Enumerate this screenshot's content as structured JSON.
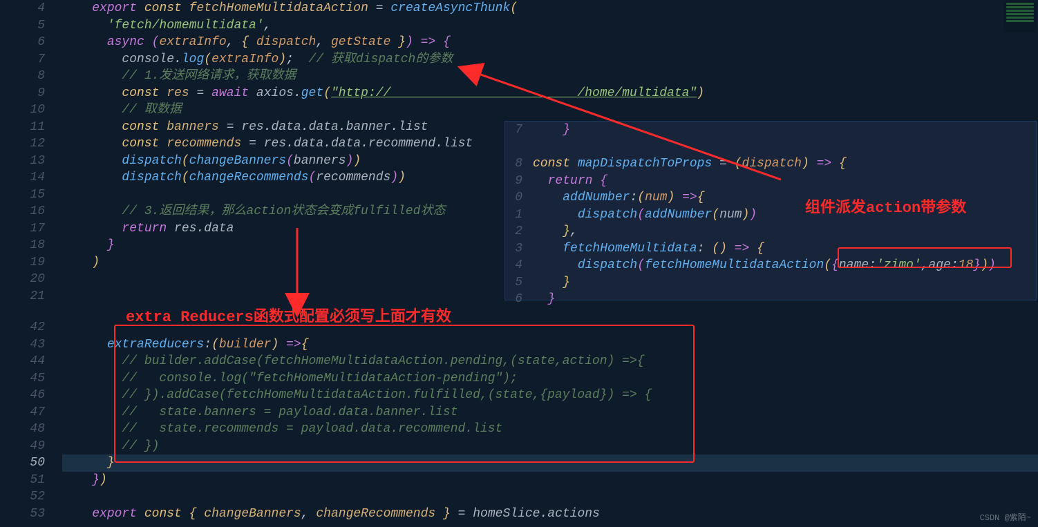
{
  "panel1": {
    "lines": [
      {
        "n": 4,
        "html": "<span class='k-export'>export</span> <span class='k-const'>const</span> <span class='varDef'>fetchHomeMultidataAction</span> <span class='punc'>=</span> <span class='fn'>createAsyncThunk</span><span class='yellow'>(</span>"
      },
      {
        "n": 5,
        "html": "  <span class='str'>'fetch/homemultidata'</span><span class='white'>,</span>"
      },
      {
        "n": 6,
        "html": "  <span class='k-async'>async</span> <span class='purple'>(</span><span class='orange'>extraInfo</span><span class='white'>,</span> <span class='yellow'>{</span> <span class='orange'>dispatch</span><span class='white'>,</span> <span class='orange'>getState</span> <span class='yellow'>}</span><span class='purple'>)</span> <span class='purple'>=&gt;</span> <span class='purple'>{</span>"
      },
      {
        "n": 7,
        "html": "    <span class='var'>console</span><span class='white'>.</span><span class='fn'>log</span><span class='yellow'>(</span><span class='orange'>extraInfo</span><span class='yellow'>)</span><span class='white'>;</span>  <span class='cmt'>// 获取dispatch的参数</span>"
      },
      {
        "n": 8,
        "html": "    <span class='cmt'>// 1.发送网络请求，获取数据</span>"
      },
      {
        "n": 9,
        "html": "    <span class='k-const'>const</span> <span class='varDef'>res</span> <span class='punc'>=</span> <span class='k-await'>await</span> <span class='var'>axios</span><span class='white'>.</span><span class='fn'>get</span><span class='yellow'>(</span><span class='strUrl'>\"http://                         /home/multidata\"</span><span class='yellow'>)</span>"
      },
      {
        "n": 10,
        "html": "    <span class='cmt'>// 取数据</span>"
      },
      {
        "n": 11,
        "html": "    <span class='k-const'>const</span> <span class='varDef'>banners</span> <span class='punc'>=</span> <span class='var'>res</span><span class='white'>.</span><span class='prop'>data</span><span class='white'>.</span><span class='prop'>data</span><span class='white'>.</span><span class='prop'>banner</span><span class='white'>.</span><span class='prop'>list</span>"
      },
      {
        "n": 12,
        "html": "    <span class='k-const'>const</span> <span class='varDef'>recommends</span> <span class='punc'>=</span> <span class='var'>res</span><span class='white'>.</span><span class='prop'>data</span><span class='white'>.</span><span class='prop'>data</span><span class='white'>.</span><span class='prop'>recommend</span><span class='white'>.</span><span class='prop'>list</span>"
      },
      {
        "n": 13,
        "html": "    <span class='fn'>dispatch</span><span class='yellow'>(</span><span class='fn'>changeBanners</span><span class='purple'>(</span><span class='var'>banners</span><span class='purple'>)</span><span class='yellow'>)</span>"
      },
      {
        "n": 14,
        "html": "    <span class='fn'>dispatch</span><span class='yellow'>(</span><span class='fn'>changeRecommends</span><span class='purple'>(</span><span class='var'>recommends</span><span class='purple'>)</span><span class='yellow'>)</span>"
      },
      {
        "n": 15,
        "html": ""
      },
      {
        "n": 16,
        "html": "    <span class='cmt'>// 3.返回结果，那么action状态会变成fulfilled状态</span>"
      },
      {
        "n": 17,
        "html": "    <span class='k-return'>return</span> <span class='var'>res</span><span class='white'>.</span><span class='prop'>data</span>"
      },
      {
        "n": 18,
        "html": "  <span class='purple'>}</span>"
      },
      {
        "n": 19,
        "html": "<span class='yellow'>)</span>"
      },
      {
        "n": 20,
        "html": ""
      },
      {
        "n": 21,
        "html": ""
      }
    ]
  },
  "panel3": {
    "lines": [
      {
        "n": 42,
        "html": ""
      },
      {
        "n": 43,
        "html": "  <span class='fn'>extraReducers</span><span class='white'>:</span><span class='yellow'>(</span><span class='orange'>builder</span><span class='yellow'>)</span> <span class='purple'>=&gt;</span><span class='yellow'>{</span>"
      },
      {
        "n": 44,
        "html": "    <span class='cmt'>// builder.addCase(fetchHomeMultidataAction.pending,(state,action) =&gt;{</span>"
      },
      {
        "n": 45,
        "html": "    <span class='cmt'>//   console.log(\"fetchHomeMultidataAction-pending\");</span>"
      },
      {
        "n": 46,
        "html": "    <span class='cmt'>// }).addCase(fetchHomeMultidataAction.fulfilled,(state,{payload}) =&gt; {</span>"
      },
      {
        "n": 47,
        "html": "    <span class='cmt'>//   state.banners = payload.data.banner.list</span>"
      },
      {
        "n": 48,
        "html": "    <span class='cmt'>//   state.recommends = payload.data.recommend.list</span>"
      },
      {
        "n": 49,
        "html": "    <span class='cmt'>// })</span>"
      },
      {
        "n": 50,
        "html": "  <span class='yellow'>}</span>",
        "cur": true,
        "hi": true
      },
      {
        "n": 51,
        "html": "<span class='purple'>}</span><span class='yellow'>)</span>"
      },
      {
        "n": 52,
        "html": ""
      },
      {
        "n": 53,
        "html": "<span class='k-export'>export</span> <span class='k-const'>const</span> <span class='yellow'>{</span> <span class='varDef'>changeBanners</span><span class='white'>,</span> <span class='varDef'>changeRecommends</span> <span class='yellow'>}</span> <span class='punc'>=</span> <span class='var'>homeSlice</span><span class='white'>.</span><span class='prop'>actions</span>"
      }
    ]
  },
  "panel2": {
    "lines": [
      {
        "n": "7",
        "html": "    <span class='purple'>}</span>"
      },
      {
        "n": "",
        "html": ""
      },
      {
        "n": "8",
        "html": "<span class='k-const'>const</span> <span class='fn'>mapDispatchToProps</span> <span class='punc'>=</span> <span class='yellow'>(</span><span class='orange'>dispatch</span><span class='yellow'>)</span> <span class='purple'>=&gt;</span> <span class='yellow'>{</span>"
      },
      {
        "n": "9",
        "html": "  <span class='k-return'>return</span> <span class='purple'>{</span>"
      },
      {
        "n": "0",
        "html": "    <span class='fn'>addNumber</span><span class='white'>:</span><span class='yellow'>(</span><span class='orange'>num</span><span class='yellow'>)</span> <span class='purple'>=&gt;</span><span class='yellow'>{</span>"
      },
      {
        "n": "1",
        "html": "      <span class='fn'>dispatch</span><span class='purple'>(</span><span class='fn'>addNumber</span><span class='yellow'>(</span><span class='var'>num</span><span class='yellow'>)</span><span class='purple'>)</span>"
      },
      {
        "n": "2",
        "html": "    <span class='yellow'>}</span><span class='white'>,</span>"
      },
      {
        "n": "3",
        "html": "    <span class='fn'>fetchHomeMultidata</span><span class='white'>:</span> <span class='yellow'>(</span><span class='yellow'>)</span> <span class='purple'>=&gt;</span> <span class='yellow'>{</span>"
      },
      {
        "n": "4",
        "html": "      <span class='fn'>dispatch</span><span class='purple'>(</span><span class='fn'>fetchHomeMultidataAction</span><span class='yellow'>(</span><span class='purple'>{</span><span class='var'>name</span><span class='white'>:</span><span class='str'>'zimo'</span><span class='white'>,</span><span class='var'>age</span><span class='white'>:</span><span class='orange'>18</span><span class='purple'>}</span><span class='yellow'>)</span><span class='purple'>)</span>"
      },
      {
        "n": "5",
        "html": "    <span class='yellow'>}</span>"
      },
      {
        "n": "6",
        "html": "  <span class='purple'>}</span>"
      }
    ]
  },
  "labels": {
    "extraReducers": "extra Reducers函数式配置必须写上面才有效",
    "dispatchArg": "组件派发action带参数"
  },
  "watermark": "CSDN @紫陌~"
}
